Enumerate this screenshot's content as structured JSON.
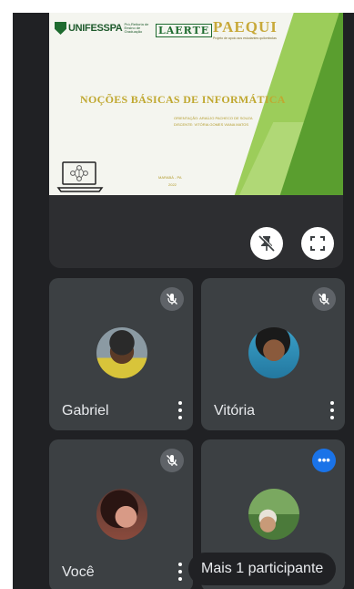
{
  "presentation": {
    "logo_left": "UNIFESSPA",
    "logo_left_sub": "Pró-Reitoria de Ensino de Graduação",
    "logo_middle": "LAERTE",
    "logo_right": "PAEQUI",
    "logo_right_sub": "Projeto de apoio aos estudantes quilombolas",
    "title": "NOÇÕES BÁSICAS DE INFORMÁTICA",
    "orientation": "ORIENTAÇÃO: ARAÚJO PACHECO DE SOUZA",
    "discente": "DISCENTE: VITÓRIA GOMES VIANA MATOS",
    "place": "MARABÁ - PA",
    "year": "2022"
  },
  "controls": {
    "unpin_icon": "unpin-icon",
    "fullscreen_icon": "fullscreen-icon"
  },
  "participants": [
    {
      "name": "Gabriel",
      "muted": true
    },
    {
      "name": "Vitória",
      "muted": true
    },
    {
      "name": "Você",
      "muted": true
    },
    {
      "name": "",
      "muted": false
    }
  ],
  "more_participants_label": "Mais 1 participante",
  "colors": {
    "background": "#202124",
    "tile": "#3c4043",
    "accent_blue": "#1a73e8"
  }
}
